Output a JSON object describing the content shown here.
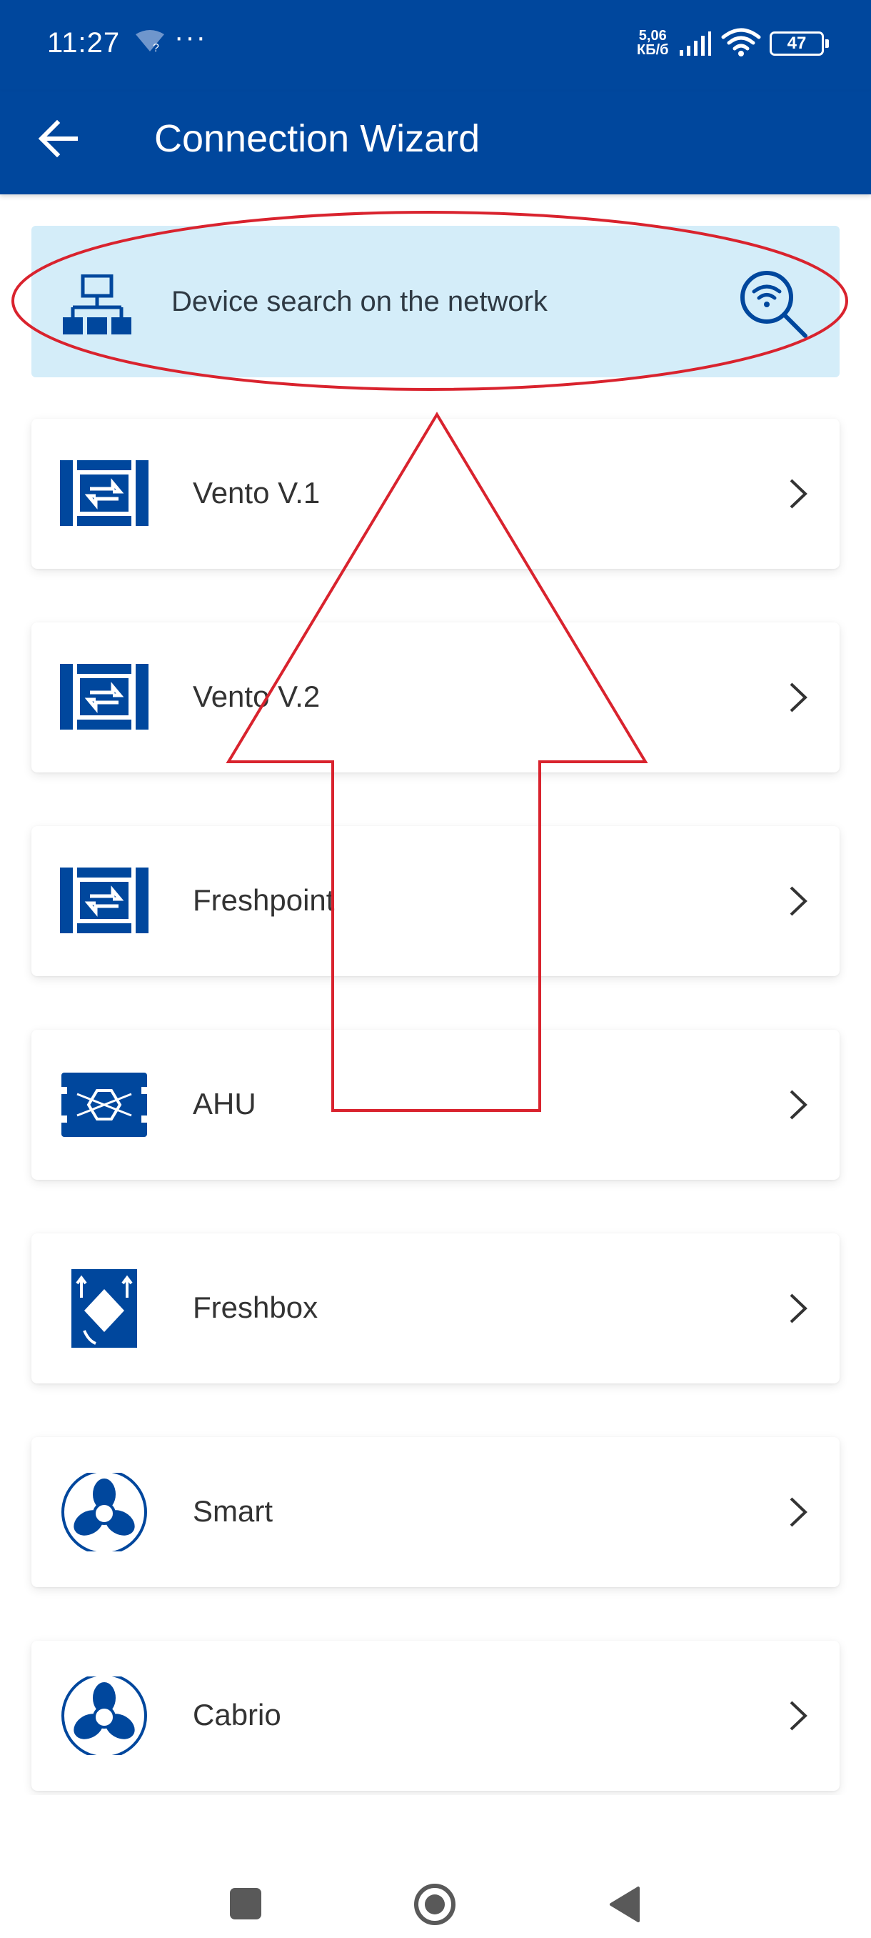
{
  "status_bar": {
    "time": "11:27",
    "dots": "···",
    "speed_top": "5,06",
    "speed_bottom": "КБ/б",
    "battery": "47"
  },
  "app_bar": {
    "title": "Connection Wizard",
    "back_icon": "arrow-left-icon"
  },
  "search": {
    "label": "Device search on the network",
    "icon_left": "network-icon",
    "icon_right": "wifi-search-icon"
  },
  "devices": [
    {
      "label": "Vento V.1",
      "icon": "vento-unit-icon"
    },
    {
      "label": "Vento V.2",
      "icon": "vento-unit-icon"
    },
    {
      "label": "Freshpoint",
      "icon": "vento-unit-icon"
    },
    {
      "label": "AHU",
      "icon": "ahu-icon"
    },
    {
      "label": "Freshbox",
      "icon": "freshbox-icon"
    },
    {
      "label": "Smart",
      "icon": "fan-icon"
    },
    {
      "label": "Cabrio",
      "icon": "fan-icon"
    }
  ],
  "colors": {
    "primary": "#00479d",
    "search_bg": "#d4edf9",
    "annotation": "#d9232e"
  },
  "nav_bar": {
    "recent_icon": "square-icon",
    "home_icon": "circle-icon",
    "back_icon": "triangle-back-icon"
  }
}
